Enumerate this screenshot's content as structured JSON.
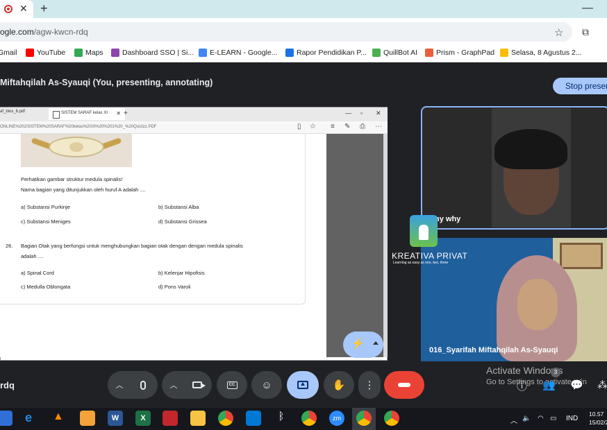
{
  "browser": {
    "tab_close": "✕",
    "new_tab": "+",
    "minimize": "—",
    "url_host": "ogle.com",
    "url_path": "/agw-kwcn-rdq",
    "bookmarks": [
      {
        "label": "Gmail",
        "color": "#ffffff"
      },
      {
        "label": "YouTube",
        "color": "#ff0000"
      },
      {
        "label": "Maps",
        "color": "#34a853"
      },
      {
        "label": "Dashboard SSO | Si...",
        "color": "#8e44ad"
      },
      {
        "label": "E-LEARN - Google...",
        "color": "#4285f4"
      },
      {
        "label": "Rapor Pendidikan P...",
        "color": "#1a73e8"
      },
      {
        "label": "QuillBot AI",
        "color": "#4caf50"
      },
      {
        "label": "Prism - GraphPad",
        "color": "#e8613c"
      },
      {
        "label": "Selasa, 8 Agustus 2...",
        "color": "#fbbc04"
      }
    ]
  },
  "meet": {
    "presenter": "Miftahqilah As-Syauqi (You, presenting, annotating)",
    "stop_button": "Stop presen",
    "meeting_code": "rdq",
    "tile1_name": "hy why",
    "tile2_name": "016_Syarifah Miftahqilah As-Syauqi",
    "brand": "KREATIVA PRIVAT",
    "brand_tagline": "Learning as easy as one, two, three",
    "participants_count": "3",
    "activate_line1": "Activate Windows",
    "activate_line2": "Go to Settings to activate Win"
  },
  "viewer": {
    "tab1": "af_bios_6.pdf",
    "tab2": "SISTEM SARAF kelas XI",
    "tab2_close": "✕",
    "new_tab": "+",
    "url": "ONLINE%202/SISTEM%20SARAF%20kelas%20XI%20%201%20_%20Quizizz.PDF"
  },
  "document": {
    "q25_text1": "Perhatikan gambar struktur medula spinalis!",
    "q25_text2": "Nama bagian yang ditunjukkan oleh huruf A adalah ....",
    "q25_options": [
      "a)  Substansi Purkinje",
      "b)  Substansi Alba",
      "c)  Substansi Meniges",
      "d)  Substansi Grissea"
    ],
    "q26_number": "26.",
    "q26_text1": "Bagian Otak yang berfungsi untuk menghubungkan bagian otak dengan dengan medula spinalis",
    "q26_text2": "adalah ....",
    "q26_options": [
      "a)  Spinal Cord",
      "b)  Kelenjar Hipofisis",
      "c)  Medulla Oblongata",
      "d)  Pons Varoli"
    ]
  },
  "taskbar": {
    "language": "IND",
    "time": "10.57",
    "date": "15/02/2"
  }
}
